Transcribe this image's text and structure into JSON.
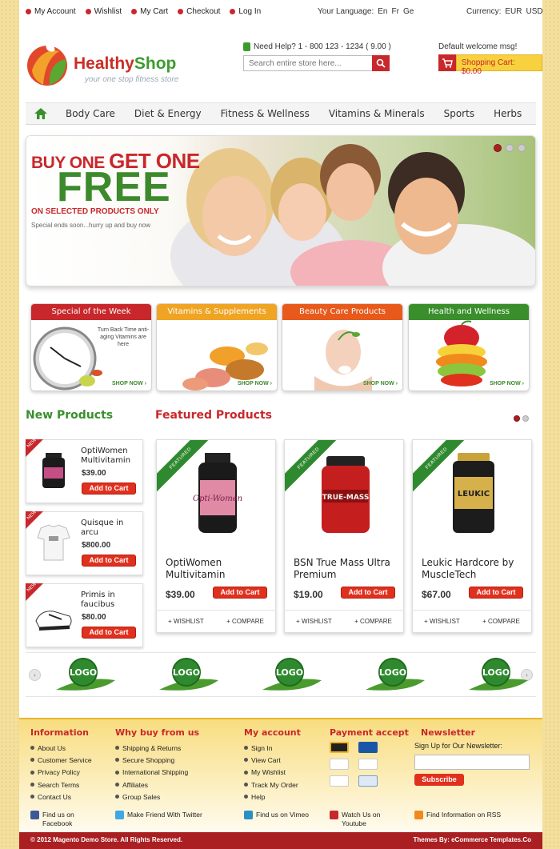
{
  "top_links": [
    "My Account",
    "Wishlist",
    "My Cart",
    "Checkout",
    "Log In"
  ],
  "language": {
    "label": "Your Language:",
    "options": [
      "En",
      "Fr",
      "Ge"
    ]
  },
  "currency": {
    "label": "Currency:",
    "options": [
      "EUR",
      "USD"
    ]
  },
  "logo": {
    "name_part1": "Healthy",
    "name_part2": "Shop",
    "tagline": "your one stop fitness store"
  },
  "help": {
    "text": "Need Help? 1 - 800 123 - 1234 ( 9.00 )"
  },
  "search": {
    "placeholder": "Search entire store here..."
  },
  "welcome": "Default welcome msg!",
  "cart": {
    "label": "Shopping Cart: $0.00"
  },
  "nav": [
    "Body Care",
    "Diet & Energy",
    "Fitness & Wellness",
    "Vitamins & Minerals",
    "Sports",
    "Herbs"
  ],
  "banner": {
    "line1_a": "BUY ONE ",
    "line1_b": "GET ONE",
    "line2": "FREE",
    "line3": "ON SELECTED PRODUCTS ONLY",
    "line4": "Special ends soon...hurry up and buy now"
  },
  "promos": [
    {
      "title": "Special of the Week",
      "text": "Turn Back Time anti-aging Vitamins are here",
      "cta": "SHOP NOW",
      "color": "#c8282b"
    },
    {
      "title": "Vitamins & Supplements",
      "text": "",
      "cta": "SHOP NOW",
      "color": "#f0a423"
    },
    {
      "title": "Beauty Care Products",
      "text": "",
      "cta": "SHOP NOW",
      "color": "#e75a1c"
    },
    {
      "title": "Health and Wellness",
      "text": "",
      "cta": "SHOP NOW",
      "color": "#3a8f2c"
    }
  ],
  "new_products": {
    "title": "New Products",
    "badge": "NEW",
    "items": [
      {
        "name": "OptiWomen Multivitamin",
        "price": "$39.00",
        "button": "Add to Cart"
      },
      {
        "name": "Quisque in arcu",
        "price": "$800.00",
        "button": "Add to Cart"
      },
      {
        "name": "Primis in faucibus",
        "price": "$80.00",
        "button": "Add to Cart"
      }
    ]
  },
  "featured": {
    "title": "Featured Products",
    "badge": "FEATURED",
    "items": [
      {
        "name": "OptiWomen Multivitamin",
        "price": "$39.00",
        "button": "Add to Cart",
        "wishlist": "+ WISHLIST",
        "compare": "+ COMPARE",
        "product_label": "Opti-Women"
      },
      {
        "name": "BSN True Mass Ultra Premium",
        "price": "$19.00",
        "button": "Add to Cart",
        "wishlist": "+ WISHLIST",
        "compare": "+ COMPARE",
        "product_label": "TRUE-MASS"
      },
      {
        "name": "Leukic Hardcore by MuscleTech",
        "price": "$67.00",
        "button": "Add to Cart",
        "wishlist": "+ WISHLIST",
        "compare": "+ COMPARE",
        "product_label": "LEUKIC"
      }
    ]
  },
  "brand_logos": [
    "LOGO",
    "LOGO",
    "LOGO",
    "LOGO",
    "LOGO"
  ],
  "footer": {
    "information": {
      "title": "Information",
      "links": [
        "About Us",
        "Customer Service",
        "Privacy Policy",
        "Search Terms",
        "Contact Us"
      ]
    },
    "why": {
      "title": "Why buy from us",
      "links": [
        "Shipping & Returns",
        "Secure Shopping",
        "International Shipping",
        "Affiliates",
        "Group Sales"
      ]
    },
    "account": {
      "title": "My account",
      "links": [
        "Sign In",
        "View Cart",
        "My Wishlist",
        "Track My Order",
        "Help"
      ]
    },
    "payment": {
      "title": "Payment accept",
      "cards": [
        "MasterCard",
        "VISA",
        "Maestro",
        "DISCOVER",
        "PayPal",
        "Cirrus"
      ]
    },
    "newsletter": {
      "title": "Newsletter",
      "label": "Sign Up for Our Newsletter:",
      "button": "Subscribe"
    },
    "social": [
      {
        "line1": "Find us on",
        "line2": "Facebook",
        "color": "#3b5998"
      },
      {
        "line1": "Make Friend With Twitter",
        "line2": "",
        "color": "#3fa9e0"
      },
      {
        "line1": "Find us on Vimeo",
        "line2": "",
        "color": "#2a8fc2"
      },
      {
        "line1": "Watch Us on",
        "line2": "Youtube",
        "color": "#c8282b"
      },
      {
        "line1": "Find Information on RSS",
        "line2": "",
        "color": "#f08a1c"
      }
    ],
    "copyright": "© 2012 Magento Demo Store. All Rights Reserved.",
    "credit": "Themes By: eCommerce Templates.Co"
  }
}
